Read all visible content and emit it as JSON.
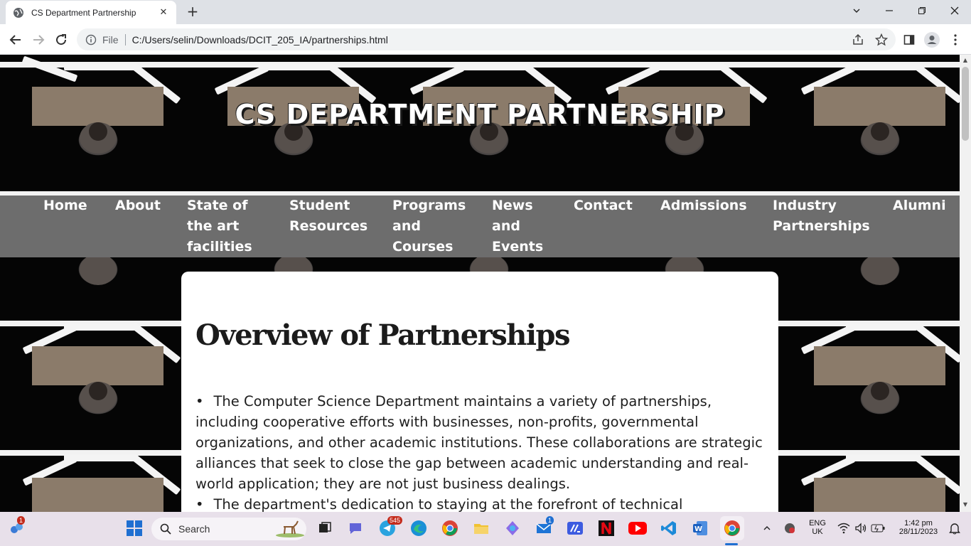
{
  "browser": {
    "tab_title": "CS Department Partnership",
    "url_scheme": "File",
    "url": "C:/Users/selin/Downloads/DCIT_205_IA/partnerships.html"
  },
  "page": {
    "hero_title": "CS DEPARTMENT PARTNERSHIP",
    "nav": [
      {
        "label": "Home"
      },
      {
        "label": "About"
      },
      {
        "label": "State of the art facilities",
        "lines": [
          "State of",
          "the art",
          "facilities"
        ]
      },
      {
        "label": "Student Resources",
        "lines": [
          "Student",
          "Resources"
        ]
      },
      {
        "label": "Programs and Courses",
        "lines": [
          "Programs",
          "and",
          "Courses"
        ]
      },
      {
        "label": "News and Events",
        "lines": [
          "News",
          "and",
          "Events"
        ]
      },
      {
        "label": "Contact"
      },
      {
        "label": "Admissions"
      },
      {
        "label": "Industry Partnerships",
        "lines": [
          "Industry",
          "Partnerships"
        ]
      },
      {
        "label": "Alumni"
      }
    ],
    "heading": "Overview of Partnerships",
    "bullets": [
      "The Computer Science Department maintains a variety of partnerships, including cooperative efforts with businesses, non-profits, governmental organizations, and other academic institutions. These collaborations are strategic alliances that seek to close the gap between academic understanding and real-world application; they are not just business dealings.",
      "The department's dedication to staying at the forefront of technical"
    ]
  },
  "taskbar": {
    "search_placeholder": "Search",
    "widgets_badge": "1",
    "telegram_badge": "545",
    "mail_badge": "1",
    "lang_top": "ENG",
    "lang_bottom": "UK",
    "time": "1:42 pm",
    "date": "28/11/2023"
  }
}
